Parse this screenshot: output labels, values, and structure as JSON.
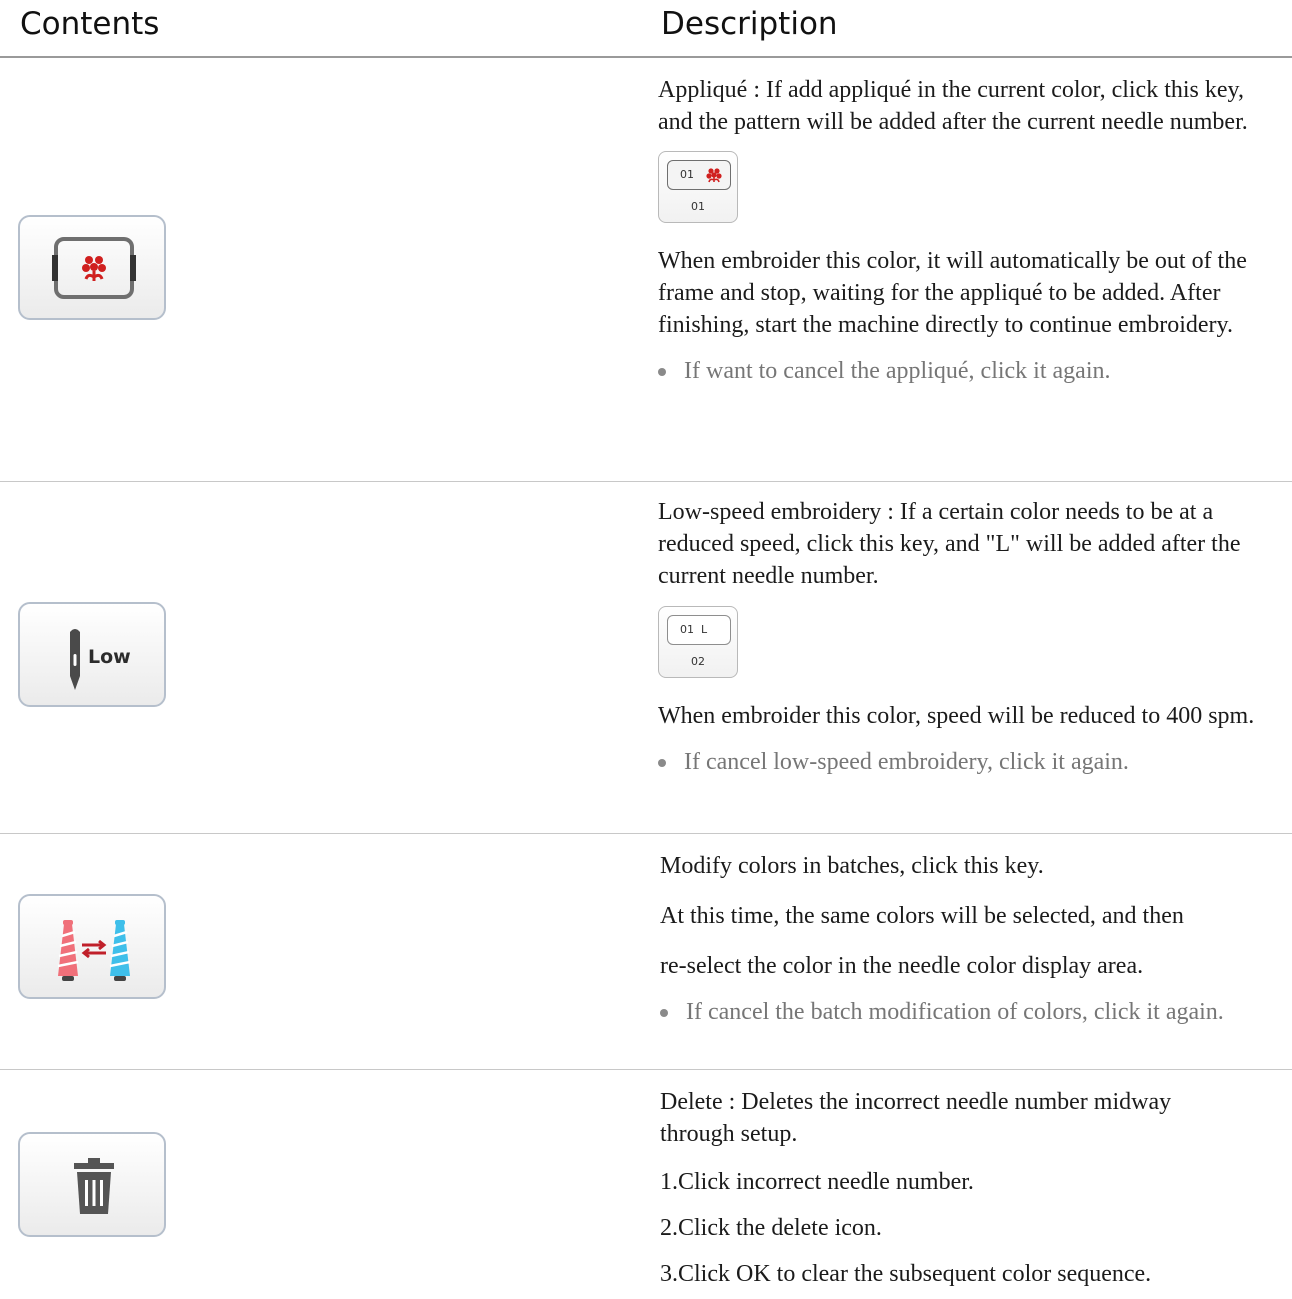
{
  "header": {
    "contents": "Contents",
    "description": "Description"
  },
  "rows": [
    {
      "key": {
        "icon": "applique-frame-icon"
      },
      "intro": "Appliqué :  If add appliqué in the current color, click this key, and the pattern will be added after the current needle number.",
      "thumb": {
        "label": "01",
        "number": "01",
        "icon": "flower-icon"
      },
      "body": "When embroider this color, it will automatically be out of the frame and stop, waiting for the appliqué to be added. After finishing, start the machine directly to continue embroidery.",
      "bullet": "If want to cancel the appliqué, click it again."
    },
    {
      "key": {
        "label": "Low",
        "icon": "needle-icon"
      },
      "intro": "Low-speed embroidery :  If a certain color needs to be at a reduced speed, click this key, and \"L\" will be added after the current needle number.",
      "thumb": {
        "label": "01  L",
        "number": "02"
      },
      "body": "When embroider this color, speed will be reduced to 400 spm.",
      "bullet": "If cancel low-speed embroidery, click it again."
    },
    {
      "key": {
        "icon": "thread-swap-icon"
      },
      "line1": "Modify colors in batches, click this key.",
      "line2": "At this time, the same colors will be selected, and then",
      "line3": "re-select the color in the needle color display area.",
      "bullet": "If cancel the batch modification of colors, click it again."
    },
    {
      "key": {
        "icon": "trash-icon"
      },
      "intro": "Delete : Deletes the incorrect needle number midway through setup.",
      "step1": "1.Click incorrect needle number.",
      "step2": "2.Click the delete icon.",
      "step3": "3.Click OK to clear the subsequent color sequence."
    }
  ],
  "colors": {
    "flower": "#d0201f",
    "thread_pink": "#f0707a",
    "thread_blue": "#3fbfea",
    "arrow": "#c0202a"
  }
}
